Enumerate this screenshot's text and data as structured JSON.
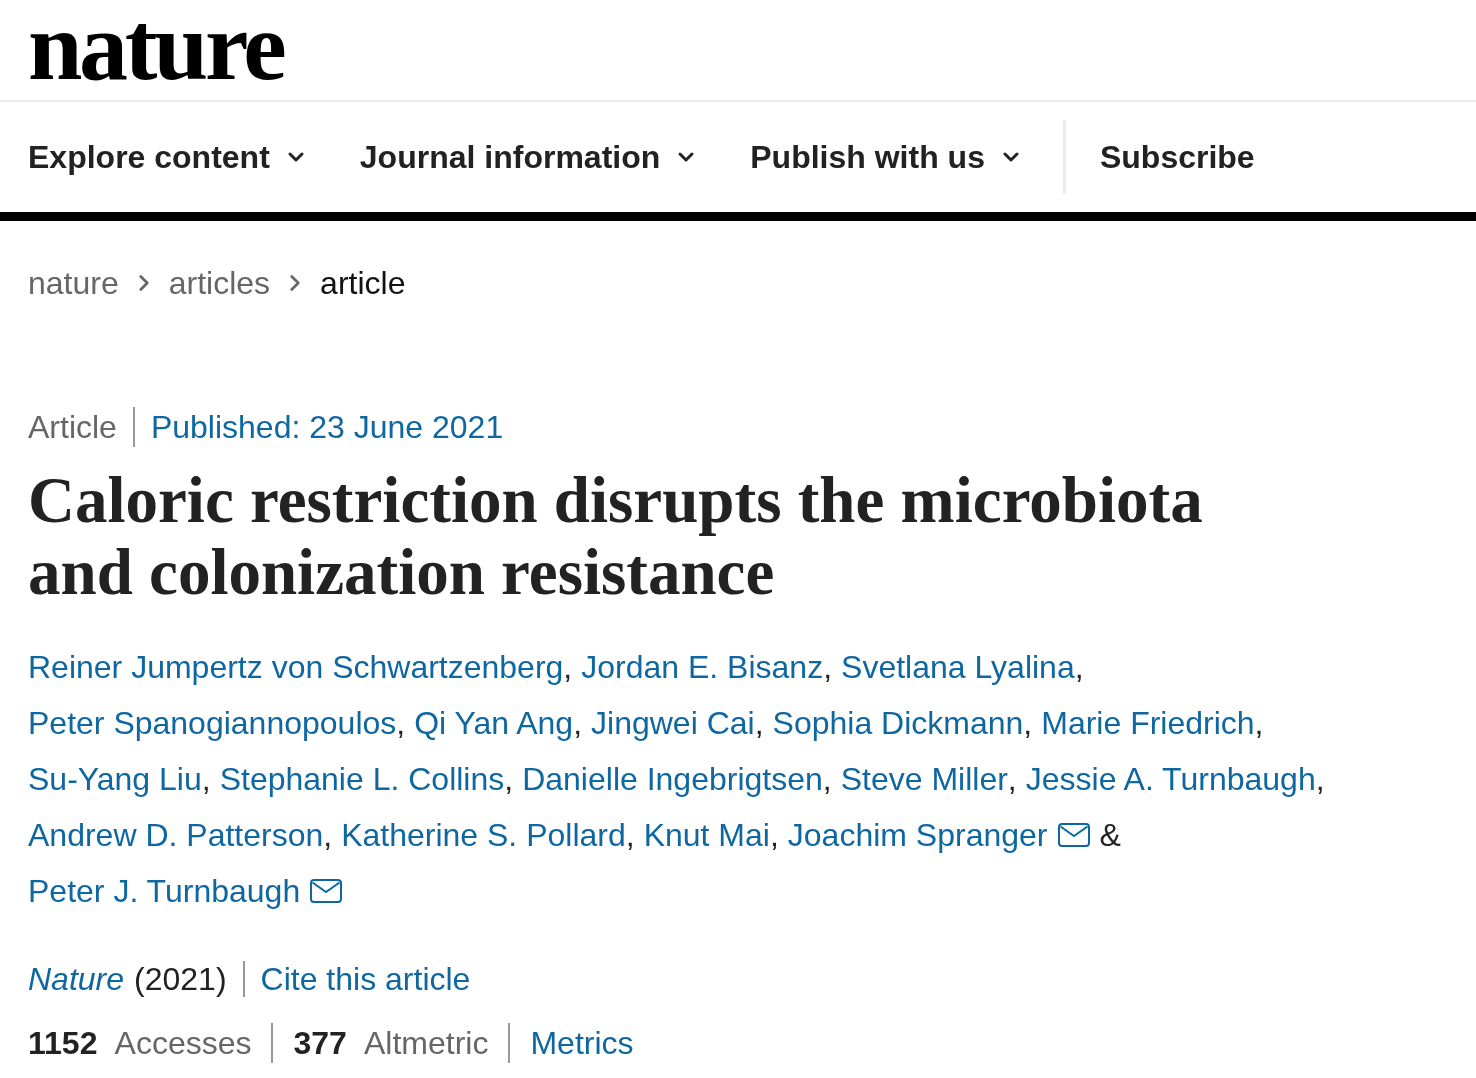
{
  "header": {
    "logo": "nature"
  },
  "nav": {
    "menus": [
      {
        "label": "Explore content",
        "has_menu": true
      },
      {
        "label": "Journal information",
        "has_menu": true
      },
      {
        "label": "Publish with us",
        "has_menu": true
      }
    ],
    "subscribe": "Subscribe"
  },
  "breadcrumb": [
    {
      "label": "nature",
      "current": false
    },
    {
      "label": "articles",
      "current": false
    },
    {
      "label": "article",
      "current": true
    }
  ],
  "article": {
    "type": "Article",
    "published": "Published: 23 June 2021",
    "title": "Caloric restriction disrupts the microbiota and colonization resistance",
    "authors": [
      {
        "name": "Reiner Jumpertz von Schwartzenberg",
        "email": false,
        "separator": ","
      },
      {
        "name": "Jordan E. Bisanz",
        "email": false,
        "separator": ","
      },
      {
        "name": "Svetlana Lyalina",
        "email": false,
        "separator": ","
      },
      {
        "name": "Peter Spanogiannopoulos",
        "email": false,
        "separator": ","
      },
      {
        "name": "Qi Yan Ang",
        "email": false,
        "separator": ","
      },
      {
        "name": "Jingwei Cai",
        "email": false,
        "separator": ","
      },
      {
        "name": "Sophia Dickmann",
        "email": false,
        "separator": ","
      },
      {
        "name": "Marie Friedrich",
        "email": false,
        "separator": ","
      },
      {
        "name": "Su-Yang Liu",
        "email": false,
        "separator": ","
      },
      {
        "name": "Stephanie L. Collins",
        "email": false,
        "separator": ","
      },
      {
        "name": "Danielle Ingebrigtsen",
        "email": false,
        "separator": ","
      },
      {
        "name": "Steve Miller",
        "email": false,
        "separator": ","
      },
      {
        "name": "Jessie A. Turnbaugh",
        "email": false,
        "separator": ","
      },
      {
        "name": "Andrew D. Patterson",
        "email": false,
        "separator": ","
      },
      {
        "name": "Katherine S. Pollard",
        "email": false,
        "separator": ","
      },
      {
        "name": "Knut Mai",
        "email": false,
        "separator": ","
      },
      {
        "name": "Joachim Spranger",
        "email": true,
        "separator": "&"
      },
      {
        "name": "Peter J. Turnbaugh",
        "email": true
      }
    ],
    "journal": {
      "name": "Nature",
      "year": "(2021)"
    },
    "cite": "Cite this article",
    "metrics": [
      "**1152** Accesses",
      "**377** Altmetric"
    ],
    "metrics_link": "Metrics"
  }
}
